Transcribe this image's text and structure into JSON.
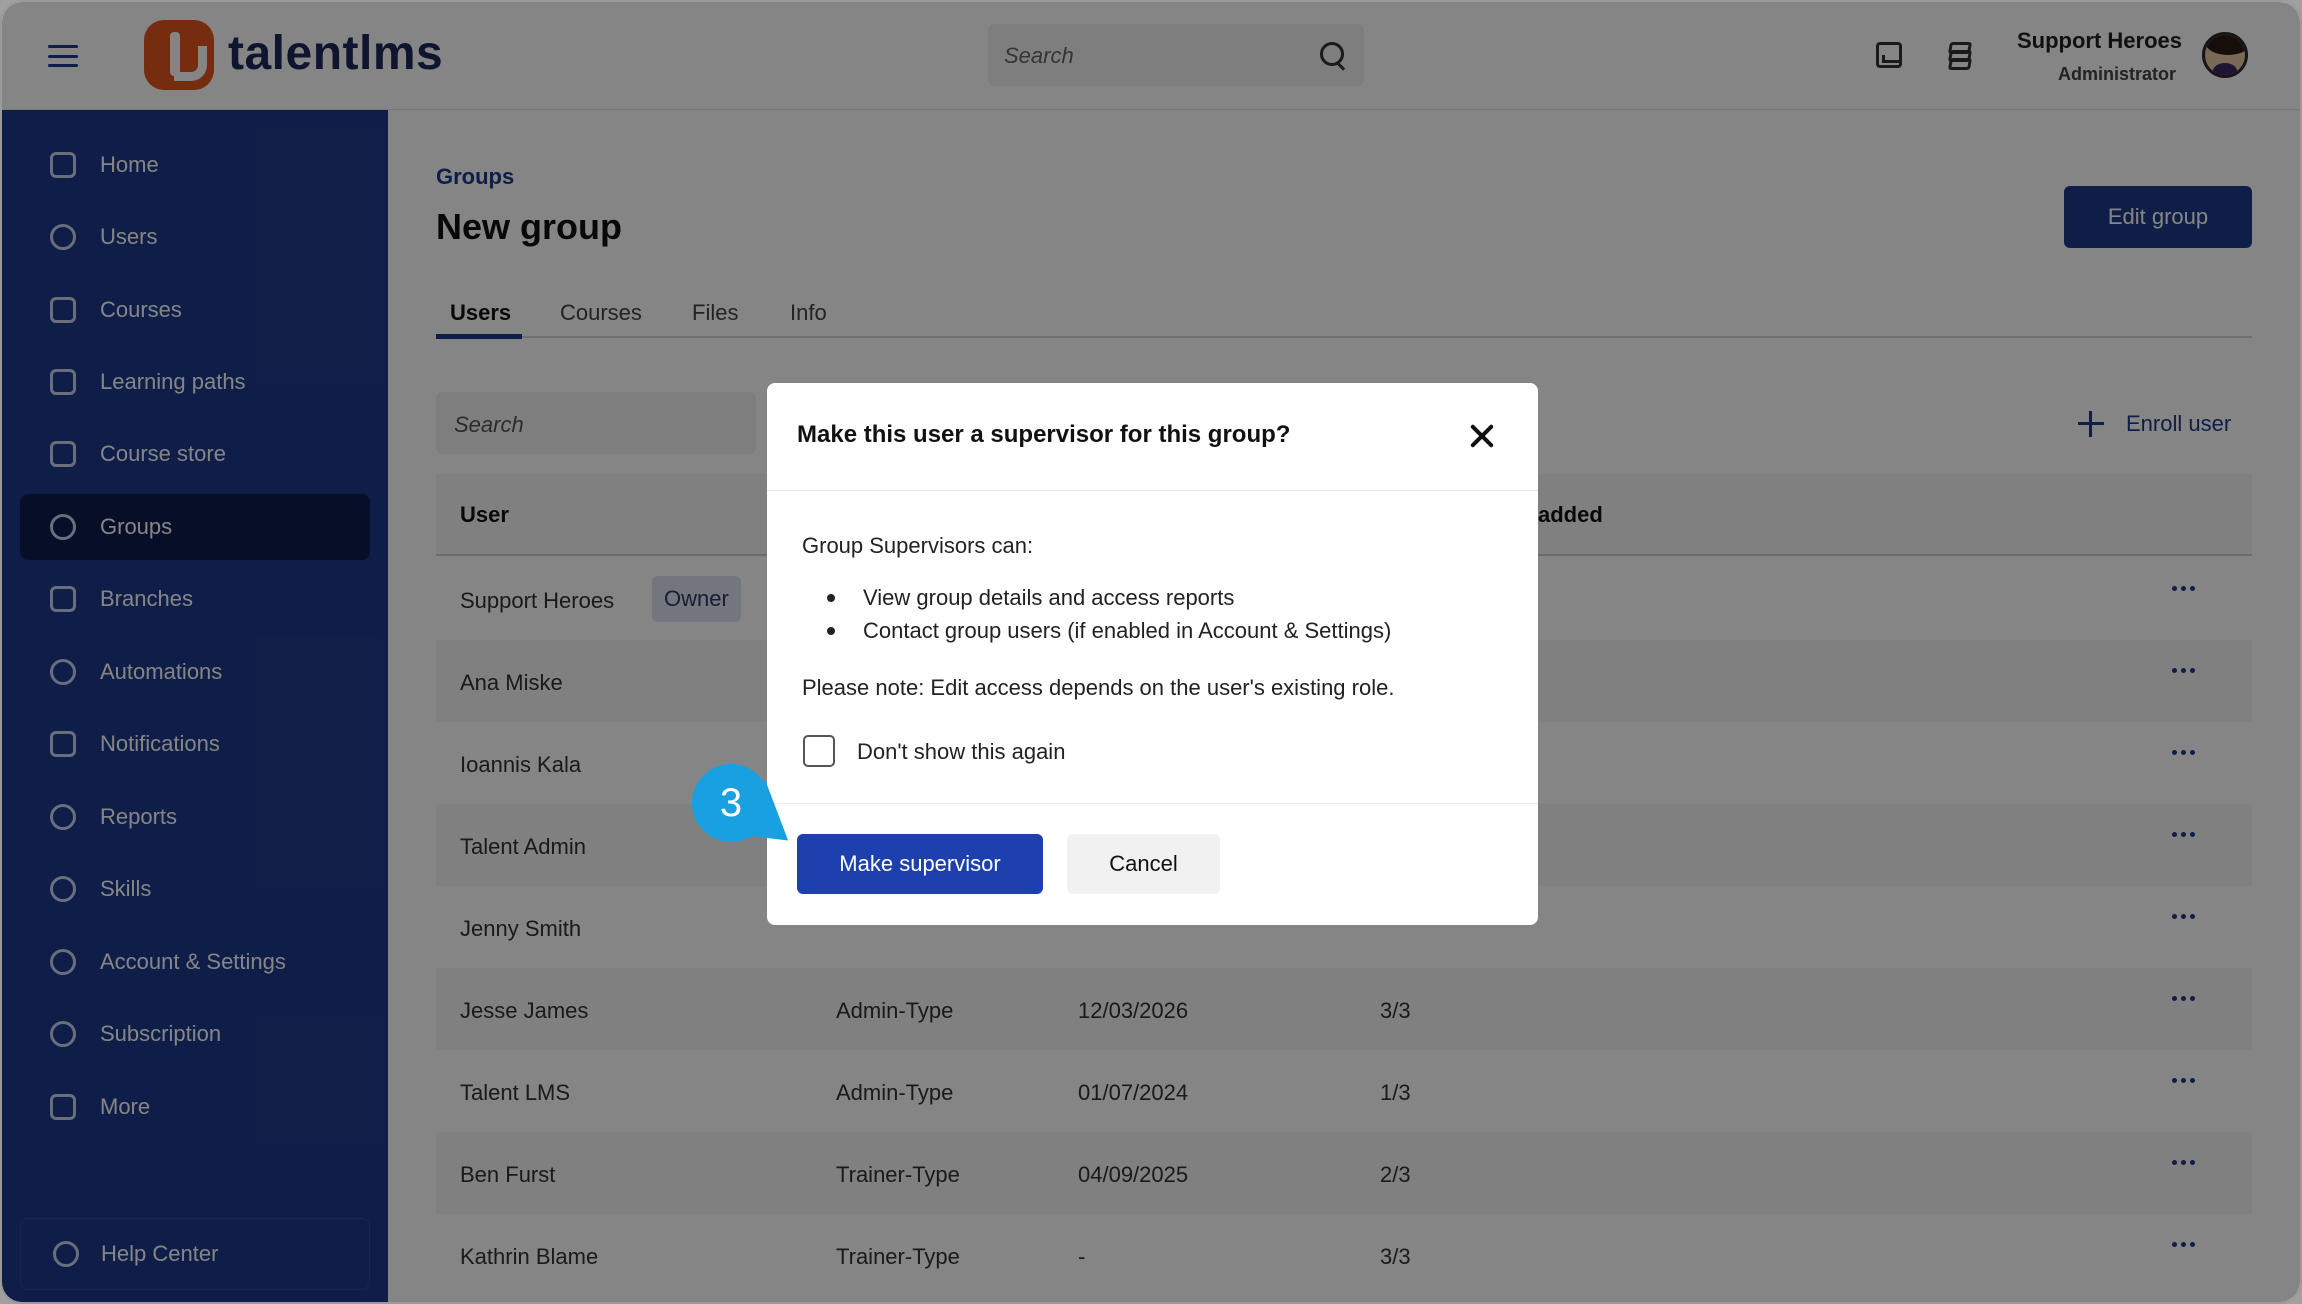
{
  "app": {
    "logo_text": "talentlms",
    "search_placeholder": "Search",
    "user_name": "Support Heroes",
    "user_role": "Administrator"
  },
  "sidebar": {
    "items": [
      {
        "label": "Home",
        "icon": "home-icon"
      },
      {
        "label": "Users",
        "icon": "user-icon"
      },
      {
        "label": "Courses",
        "icon": "book-icon"
      },
      {
        "label": "Learning paths",
        "icon": "path-icon"
      },
      {
        "label": "Course store",
        "icon": "store-icon"
      },
      {
        "label": "Groups",
        "icon": "groups-icon",
        "active": true
      },
      {
        "label": "Branches",
        "icon": "layers-icon"
      },
      {
        "label": "Automations",
        "icon": "automation-icon"
      },
      {
        "label": "Notifications",
        "icon": "megaphone-icon"
      },
      {
        "label": "Reports",
        "icon": "pie-chart-icon"
      },
      {
        "label": "Skills",
        "icon": "brain-icon"
      },
      {
        "label": "Account & Settings",
        "icon": "gear-icon"
      },
      {
        "label": "Subscription",
        "icon": "refresh-icon"
      },
      {
        "label": "More",
        "icon": "grid-icon"
      }
    ],
    "help_label": "Help Center"
  },
  "page": {
    "breadcrumb": "Groups",
    "title": "New group",
    "edit_button": "Edit group",
    "tabs": [
      "Users",
      "Courses",
      "Files",
      "Info"
    ],
    "list_search_placeholder": "Search",
    "enroll_label": "Enroll user",
    "table": {
      "headers": {
        "user": "User",
        "date_added": "added"
      },
      "owner_badge": "Owner",
      "rows": [
        {
          "user": "Support Heroes",
          "type": "",
          "date": "",
          "courses": ""
        },
        {
          "user": "Ana Miske",
          "type": "",
          "date": "",
          "courses": ""
        },
        {
          "user": "Ioannis Kala",
          "type": "",
          "date": "",
          "courses": ""
        },
        {
          "user": "Talent Admin",
          "type": "",
          "date": "",
          "courses": ""
        },
        {
          "user": "Jenny Smith",
          "type": "",
          "date": "",
          "courses": ""
        },
        {
          "user": "Jesse James",
          "type": "Admin-Type",
          "date": "12/03/2026",
          "courses": "3/3"
        },
        {
          "user": "Talent LMS",
          "type": "Admin-Type",
          "date": "01/07/2024",
          "courses": "1/3"
        },
        {
          "user": "Ben Furst",
          "type": "Trainer-Type",
          "date": "04/09/2025",
          "courses": "2/3"
        },
        {
          "user": "Kathrin Blame",
          "type": "Trainer-Type",
          "date": "-",
          "courses": "3/3"
        }
      ]
    }
  },
  "modal": {
    "title": "Make this user a supervisor for this group?",
    "intro": "Group Supervisors can:",
    "bullets": [
      "View group details and access reports",
      "Contact group users (if enabled in Account & Settings)"
    ],
    "note": "Please note: Edit access depends on the user's existing role.",
    "checkbox_label": "Don't show this again",
    "primary_button": "Make supervisor",
    "cancel_button": "Cancel"
  },
  "callout": {
    "step": "3",
    "color": "#18a0e0"
  },
  "colors": {
    "brand": "#1e3a8a",
    "accent": "#e2571e"
  }
}
